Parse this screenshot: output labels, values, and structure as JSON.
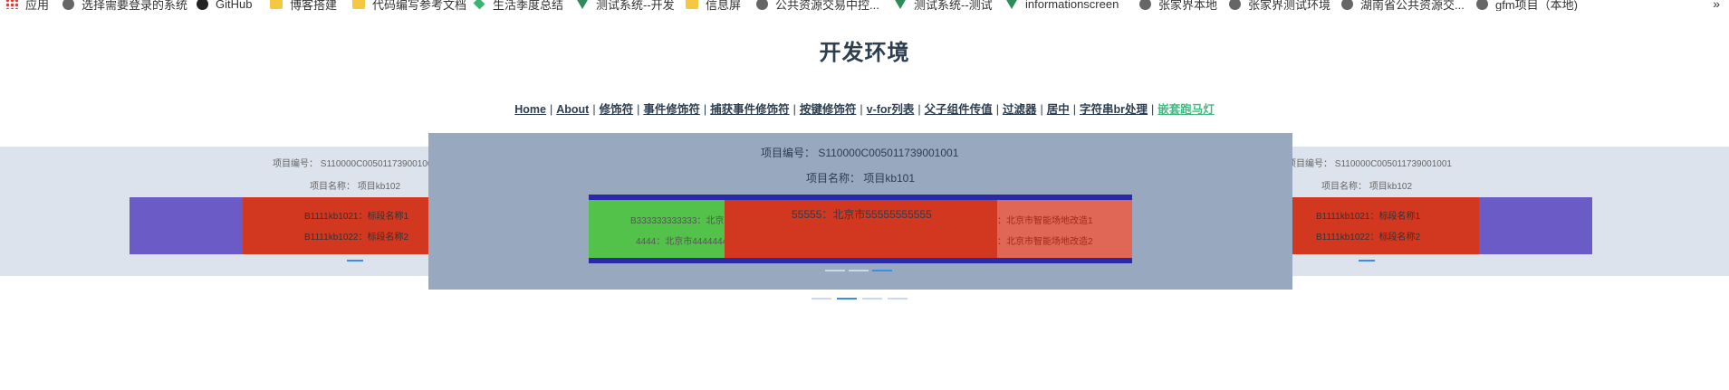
{
  "bookmarks": [
    {
      "label": "应用",
      "icon": "apps-grid-icon"
    },
    {
      "label": "选择需要登录的系统",
      "icon": "globe-icon"
    },
    {
      "label": "GitHub",
      "icon": "github-icon"
    },
    {
      "label": "博客搭建",
      "icon": "folder-icon"
    },
    {
      "label": "代码编写参考文档",
      "icon": "folder-icon"
    },
    {
      "label": "生活季度总结",
      "icon": "gem-icon"
    },
    {
      "label": "测试系统--开发",
      "icon": "vue-icon"
    },
    {
      "label": "信息屏",
      "icon": "folder-icon"
    },
    {
      "label": "公共资源交易中控...",
      "icon": "globe-icon"
    },
    {
      "label": "测试系统--测试",
      "icon": "vue-icon"
    },
    {
      "label": "informationscreen",
      "icon": "vue-icon"
    },
    {
      "label": "张家界本地",
      "icon": "globe-icon"
    },
    {
      "label": "张家界测试环境",
      "icon": "globe-icon"
    },
    {
      "label": "湖南省公共资源交...",
      "icon": "globe-icon"
    },
    {
      "label": "gfm项目（本地)",
      "icon": "globe-icon"
    }
  ],
  "more_label": "»",
  "page_title": "开发环境",
  "nav": {
    "links": [
      "Home",
      "About",
      "修饰符",
      "事件修饰符",
      "捕获事件修饰符",
      "按键修饰符",
      "v-for列表",
      "父子组件传值",
      "过滤器",
      "居中",
      "字符串br处理",
      "嵌套跑马灯"
    ],
    "active_index": 11,
    "separator": "|"
  },
  "back_left": {
    "project_no": "项目编号：  S110000C00501173900100",
    "project_name": "项目名称：   项目kb102",
    "items": [
      "B1111kb1021：标段名称1",
      "B1111kb1022：标段名称2"
    ]
  },
  "back_right": {
    "project_no": "项目编号：  S110000C005011739001001",
    "project_name": "项目名称：   项目kb102",
    "items": [
      "B1111kb1021：标段名称1",
      "B1111kb1022：标段名称2"
    ]
  },
  "modal": {
    "project_no": "项目编号：   S110000C005011739001001",
    "project_name": "项目名称：   项目kb101",
    "left_items": [
      "B333333333333：北京",
      "4444：北京市4444444"
    ],
    "center_item": "55555：北京市55555555555",
    "right_items": [
      "：北京市智能场地改造1",
      "：北京市智能场地改造2"
    ]
  },
  "colors": {
    "purple": "#6a5bc7",
    "red": "#d2371f",
    "green": "#53c24b",
    "salmon": "#e06656",
    "navy": "#2a2aa8",
    "modal_bg": "#97a8bf",
    "band_bg": "#dde3ec",
    "active_link": "#42b983",
    "indicator": "#3a8ee6"
  }
}
